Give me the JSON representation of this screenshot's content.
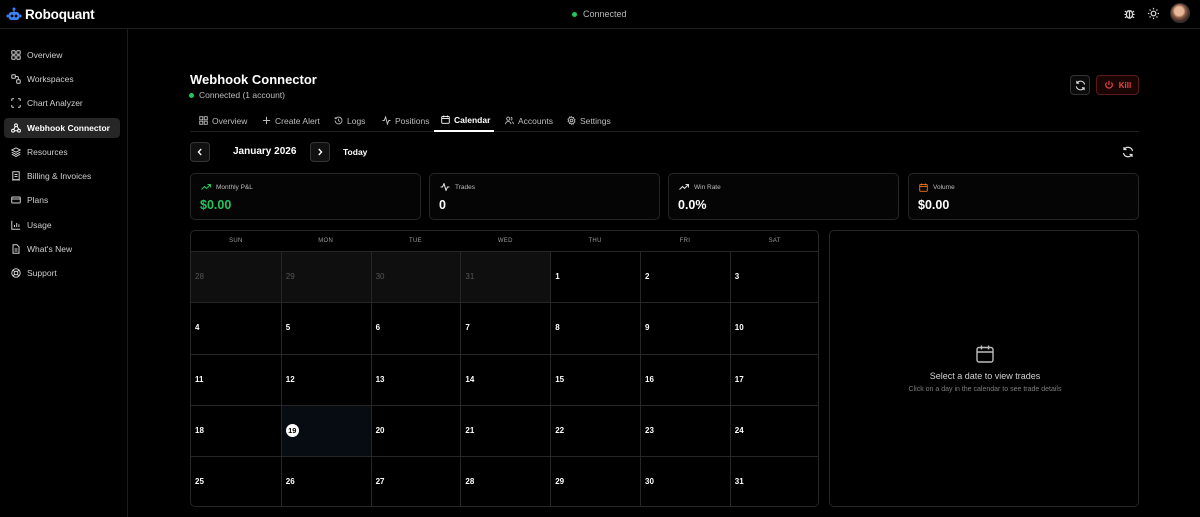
{
  "app": {
    "name": "Roboquant",
    "status": "Connected"
  },
  "sidebar": {
    "items": [
      {
        "label": "Overview",
        "icon": "grid-icon"
      },
      {
        "label": "Workspaces",
        "icon": "workspaces-icon"
      },
      {
        "label": "Chart Analyzer",
        "icon": "scan-icon"
      },
      {
        "label": "Webhook Connector",
        "icon": "webhook-icon",
        "active": true
      },
      {
        "label": "Resources",
        "icon": "layers-icon"
      },
      {
        "label": "Billing & Invoices",
        "icon": "receipt-icon"
      },
      {
        "label": "Plans",
        "icon": "card-icon"
      },
      {
        "label": "Usage",
        "icon": "bar-chart-icon"
      },
      {
        "label": "What's New",
        "icon": "document-icon"
      },
      {
        "label": "Support",
        "icon": "lifebuoy-icon"
      }
    ]
  },
  "header": {
    "title": "Webhook Connector",
    "status": "Connected (1 account)",
    "kill_label": "Kill"
  },
  "tabs": [
    {
      "label": "Overview",
      "icon": "grid-icon"
    },
    {
      "label": "Create Alert",
      "icon": "plus-icon"
    },
    {
      "label": "Logs",
      "icon": "history-icon"
    },
    {
      "label": "Positions",
      "icon": "activity-icon"
    },
    {
      "label": "Calendar",
      "icon": "calendar-icon",
      "active": true
    },
    {
      "label": "Accounts",
      "icon": "users-icon"
    },
    {
      "label": "Settings",
      "icon": "gear-icon"
    }
  ],
  "calendar": {
    "month_label": "January 2026",
    "today_label": "Today",
    "weekdays": [
      "SUN",
      "MON",
      "TUE",
      "WED",
      "THU",
      "FRI",
      "SAT"
    ],
    "days": [
      [
        "28",
        "29",
        "30",
        "31",
        "1",
        "2",
        "3"
      ],
      [
        "4",
        "5",
        "6",
        "7",
        "8",
        "9",
        "10"
      ],
      [
        "11",
        "12",
        "13",
        "14",
        "15",
        "16",
        "17"
      ],
      [
        "18",
        "19",
        "20",
        "21",
        "22",
        "23",
        "24"
      ],
      [
        "25",
        "26",
        "27",
        "28",
        "29",
        "30",
        "31"
      ]
    ],
    "outside_month_count_first_row": 4,
    "today": "19"
  },
  "stats": [
    {
      "label": "Monthly P&L",
      "value": "$0.00",
      "icon": "trending-up-icon",
      "color": "#22c55e"
    },
    {
      "label": "Trades",
      "value": "0",
      "icon": "activity-icon"
    },
    {
      "label": "Win Rate",
      "value": "0.0%",
      "icon": "trending-up-icon"
    },
    {
      "label": "Volume",
      "value": "$0.00",
      "icon": "calendar-icon",
      "color": "#f97316"
    }
  ],
  "detail": {
    "title": "Select a date to view trades",
    "subtitle": "Click on a day in the calendar to see trade details"
  },
  "colors": {
    "accent_green": "#22c55e",
    "danger": "#ef4444",
    "volume_orange": "#f97316"
  }
}
